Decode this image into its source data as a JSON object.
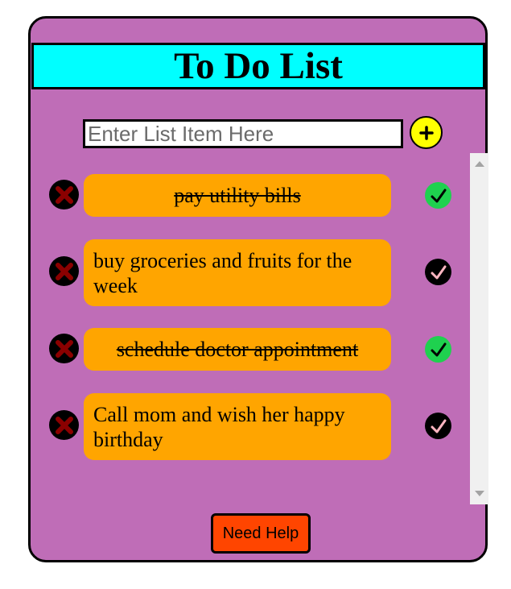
{
  "header": {
    "title": "To Do List"
  },
  "input": {
    "placeholder": "Enter List Item Here",
    "value": ""
  },
  "add_button": {
    "label": "+"
  },
  "items": [
    {
      "text": "pay utility bills",
      "completed": true
    },
    {
      "text": "buy groceries and fruits for the week",
      "completed": false
    },
    {
      "text": "schedule doctor appointment",
      "completed": true
    },
    {
      "text": "Call mom and wish her happy birthday",
      "completed": false
    }
  ],
  "help_button": {
    "label": "Need Help"
  },
  "colors": {
    "background": "#bf6db7",
    "header": "#00ffff",
    "task": "#ffa500",
    "add_button": "#ffff00",
    "help_button": "#ff4500",
    "check_done": "#1fd14f",
    "delete_x": "#8b0000"
  },
  "icons": {
    "delete": "x-circle-icon",
    "check": "checkmark-circle-icon",
    "add": "plus-icon"
  }
}
